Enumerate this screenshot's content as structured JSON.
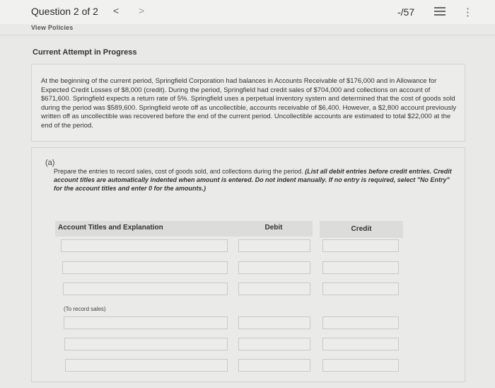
{
  "header": {
    "question_label": "Question 2 of 2",
    "prev_symbol": "<",
    "next_symbol": ">",
    "score": "-/57",
    "more_symbol": "⋮"
  },
  "view_policies": "View Policies",
  "attempt_status": "Current Attempt in Progress",
  "problem": {
    "text": "At the beginning of the current period, Springfield Corporation had balances in Accounts Receivable of $176,000 and in Allowance for Expected Credit Losses of $8,000 (credit). During the period, Springfield had credit sales of $704,000 and collections on account of $671,600. Springfield expects a return rate of 5%. Springfield uses a perpetual inventory system and determined that the cost of goods sold during the period was $589,600. Springfield wrote off as uncollectible, accounts receivable of $6,400. However, a $2,800 account previously written off as uncollectible was recovered before the end of the current period. Uncollectible accounts are estimated to total $22,000 at the end of the period."
  },
  "part_a": {
    "label": "(a)",
    "instruction_plain": "Prepare the entries to record sales, cost of goods sold, and collections during the period. ",
    "instruction_emphasis": "(List all debit entries before credit entries. Credit account titles are automatically indented when amount is entered. Do not indent manually. If no entry is required, select \"No Entry\" for the account titles and enter 0 for the amounts.)",
    "table": {
      "headers": {
        "account": "Account Titles and Explanation",
        "debit": "Debit",
        "credit": "Credit"
      },
      "entry_note": "(To record sales)"
    }
  }
}
